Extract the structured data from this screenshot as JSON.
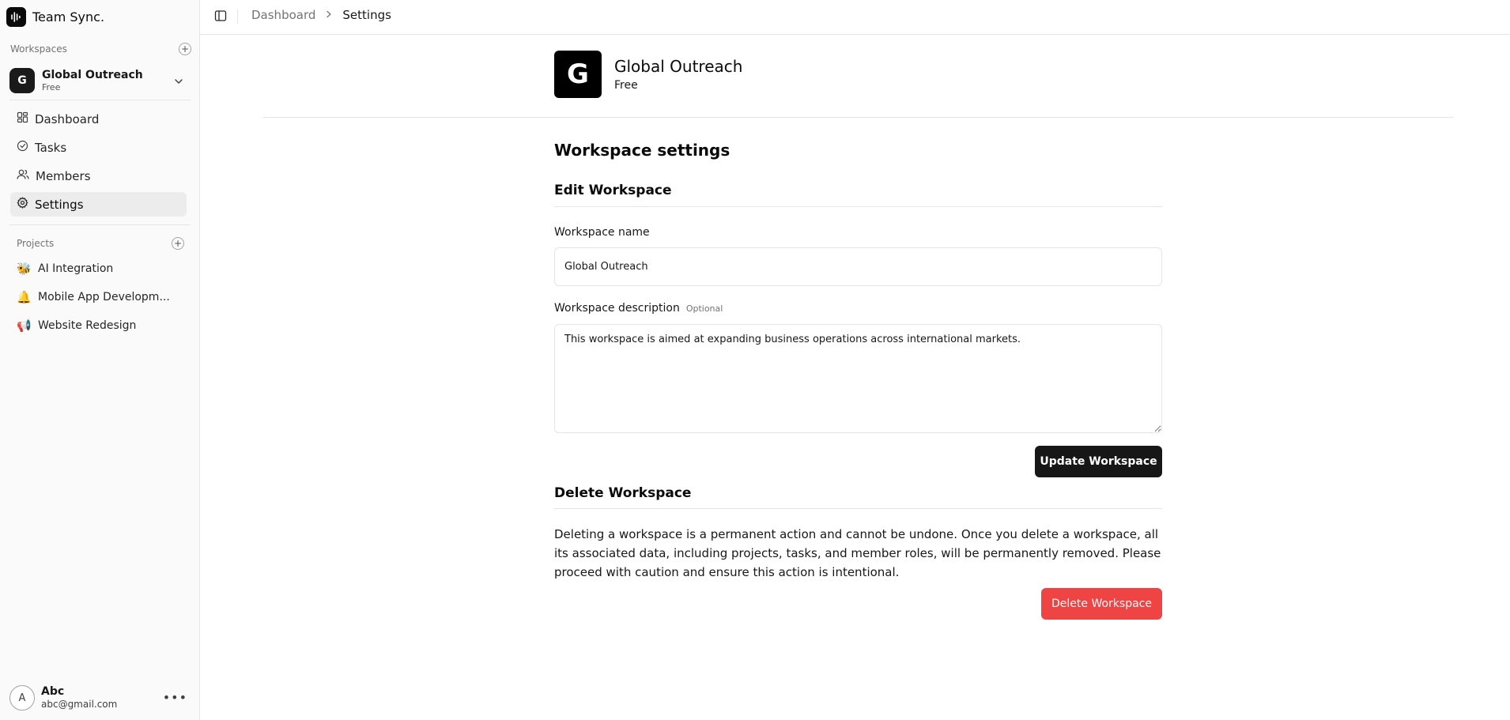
{
  "brand": {
    "name": "Team Sync."
  },
  "sidebar": {
    "workspaces_label": "Workspaces",
    "current_workspace": {
      "initial": "G",
      "name": "Global Outreach",
      "plan": "Free"
    },
    "nav": [
      {
        "label": "Dashboard",
        "icon": "dashboard-icon"
      },
      {
        "label": "Tasks",
        "icon": "check-circle-icon"
      },
      {
        "label": "Members",
        "icon": "users-icon"
      },
      {
        "label": "Settings",
        "icon": "gear-icon",
        "active": true
      }
    ],
    "projects_label": "Projects",
    "projects": [
      {
        "emoji": "🐝",
        "label": "AI Integration"
      },
      {
        "emoji": "🔔",
        "label": "Mobile App Developm..."
      },
      {
        "emoji": "📢",
        "label": "Website Redesign"
      }
    ],
    "user": {
      "initial": "A",
      "name": "Abc",
      "email": "abc@gmail.com"
    }
  },
  "topbar": {
    "breadcrumb": [
      "Dashboard",
      "Settings"
    ]
  },
  "header": {
    "initial": "G",
    "name": "Global Outreach",
    "plan": "Free"
  },
  "settings": {
    "title": "Workspace settings",
    "edit_title": "Edit Workspace",
    "name_label": "Workspace name",
    "name_value": "Global Outreach",
    "desc_label": "Workspace description",
    "desc_optional": "Optional",
    "desc_value": "This workspace is aimed at expanding business operations across international markets.",
    "update_button": "Update Workspace",
    "delete_title": "Delete Workspace",
    "delete_warning": "Deleting a workspace is a permanent action and cannot be undone. Once you delete a workspace, all its associated data, including projects, tasks, and member roles, will be permanently removed. Please proceed with caution and ensure this action is intentional.",
    "delete_button": "Delete Workspace"
  },
  "colors": {
    "primary": "#171717",
    "danger": "#ef4444",
    "sidebar_bg": "#fafafa",
    "border": "#e5e5e5"
  }
}
